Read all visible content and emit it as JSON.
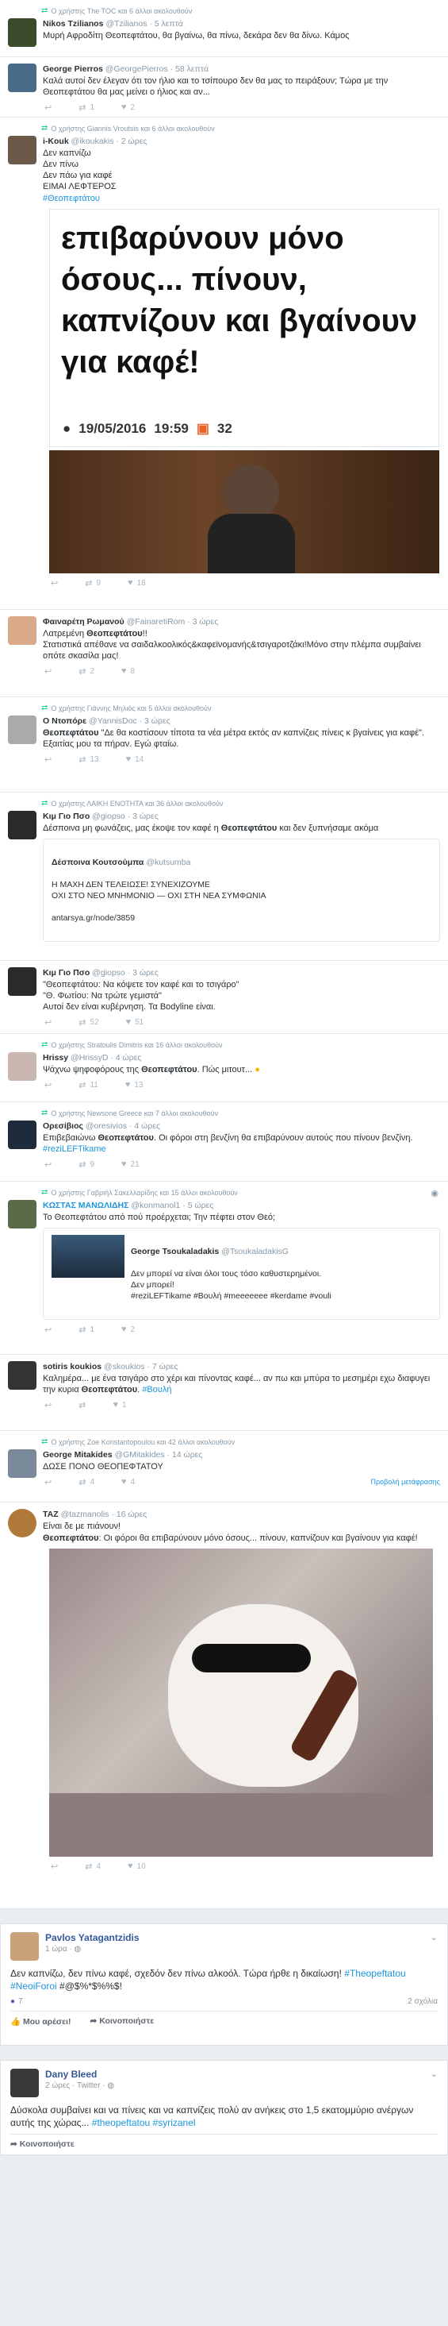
{
  "tweets": {
    "t1": {
      "rt": "Ο χρήστης The TOC και 6 άλλοι ακολουθούν",
      "name": "Nikos Tzilianos",
      "handle": "@Tzilianos · 5 λεπτά",
      "text": "Μυρή Αφροδίτη Θεοπεφτάτου, θα βγαίνω, θα πίνω, δεκάρα δεν θα δίνω. Κάμος"
    },
    "t2": {
      "name": "George Pierros",
      "handle": "@GeorgePierros · 58 λεπτά",
      "text": "Καλά αυτοί δεν έλεγαν ότι τον ήλιο και το τσίπουρο δεν θα μας το πειράξουν; Τώρα με την Θεοπεφτάτου θα μας μείνει ο ήλιος και αν...",
      "replies": "",
      "retweets": "1",
      "likes": "2"
    },
    "t3": {
      "rt": "Ο χρήστης Giannis Vroutsis και 6 άλλοι ακολουθούν",
      "name": "i-Kouk",
      "handle": "@ikoukakis · 2 ώρες",
      "text": "Δεν καπνίζω\nΔεν πίνω\nΔεν πάω για καφέ\nΕΙΜΑΙ ΛΕΦΤΕΡΟΣ",
      "hashtag": "#Θεοπεφτάτου",
      "card_text": "επιβαρύνουν μόνο όσους... πίνουν, καπνίζουν και βγαίνουν για καφέ!",
      "card_date": "19/05/2016",
      "card_time": "19:59",
      "card_comments": "32",
      "retweets": "9",
      "likes": "18"
    },
    "t4": {
      "name": "Φαιναρέτη Ρωμανού",
      "handle": "@FainaretiRom · 3 ώρες",
      "text_a": "Λατρεμένη ",
      "bold": "Θεοπεφτάτου",
      "text_b": "!!\nΣτατιστικά απέθανε να σαιδαλκοολικός&καφεϊνομανής&τσιγαροτζάκι!Μόνο στην πλέμπα συμβαίνει οπότε σκασίλα μας!",
      "retweets": "2",
      "likes": "8"
    },
    "t5": {
      "rt": "Ο χρήστης Γιάννης Μηλιός και 5 άλλοι ακολουθούν",
      "name": "Ο Ντοπόρε",
      "handle": "@YannisDoc · 3 ώρες",
      "bold": "Θεοπεφτάτου",
      "text_b": " \"Δε θα κοστίσουν τίποτα τα νέα μέτρα εκτός αν καπνίζεις πίνεις κ βγαίνεις για καφέ\".\nΕξαιτίας μου τα πήραν. Εγώ φταίω.",
      "retweets": "13",
      "likes": "14"
    },
    "t6": {
      "rt": "Ο χρήστης ΛΑΙΚΗ ΕΝΟΤΗΤΑ και 36 άλλοι ακολουθούν",
      "name": "Κιμ Γιο Πσο",
      "handle": "@giopso · 3 ώρες",
      "text_a": "Δέσποινα μη φωνάζεις, μας έκοψε τον καφέ η ",
      "bold": "Θεοπεφτάτου",
      "text_b": " και δεν ξυπνήσαμε ακόμα",
      "quote_name": "Δέσποινα Κουτσούμπα",
      "quote_handle": "@kutsumba",
      "quote_text": "Η ΜΑΧΗ ΔΕΝ ΤΕΛΕΙΩΣΕ! ΣΥΝΕΧΙΖΟΥΜΕ\nΟΧΙ ΣΤΟ ΝΕΟ ΜΝΗΜΟΝΙΟ — ΟΧΙ ΣΤΗ ΝΕΑ ΣΥΜΦΩΝΙΑ\n\nantarsya.gr/node/3859"
    },
    "t7": {
      "name": "Κιμ Γιο Πσο",
      "handle": "@giopso · 3 ώρες",
      "text": "\"Θεοπεφτάτου: Να κόψετε τον καφέ και το τσιγάρο\"\n\"Θ. Φωτίου: Να τρώτε γεμιστά\"\nΑυτοί δεν είναι κυβέρνηση. Τα Bodyline είναι.",
      "retweets": "52",
      "likes": "51"
    },
    "t8": {
      "rt": "Ο χρήστης Stratoulis Dimitris και 16 άλλοι ακολουθούν",
      "name": "Hrissy",
      "handle": "@HrissyD · 4 ώρες",
      "text_a": "Ψάχνω ψηφοφόρους της ",
      "bold": "Θεοπεφτάτου",
      "text_b": ". Πώς μιτουτ... ",
      "retweets": "11",
      "likes": "13"
    },
    "t9": {
      "rt": "Ο χρήστης Newsone Greece και 7 άλλοι ακολουθούν",
      "name": "Ορεσίβιος",
      "handle": "@oresivios · 4 ώρες",
      "text_a": "Επιβεβαιώνω ",
      "bold": "Θεοπεφτάτου",
      "text_b": ". Οι φόροι στη βενζίνη θα επιβαρύνουν αυτούς που πίνουν βενζίνη. ",
      "hashtag": "#reziLEFTikame",
      "retweets": "9",
      "likes": "21"
    },
    "t10": {
      "rt": "Ο χρήστης Γαβριήλ Σακελλαρίδης και 15 άλλοι ακολουθούν",
      "name": "ΚΩΣΤΑΣ ΜΑΝΩΛΙΔΗΣ",
      "handle": "@konmanol1 · 5 ώρες",
      "text": "Το Θεοπεφτάτου από πού προέρχεται; Την πέφτει στον Θεό;",
      "quote_name": "George Tsoukaladakis",
      "quote_handle": "@TsoukaladakisG",
      "quote_text": "Δεν μπορεί να είναι όλοι τους τόσο καθυστερημένοι.\nΔεν μπορεί!\n#reziLEFTikame #Βουλή #meeeeeee #kerdame #vouli",
      "retweets": "1",
      "likes": "2"
    },
    "t11": {
      "name": "sotiris koukios",
      "handle": "@skoukios · 7 ώρες",
      "text_a": "Καλημέρα... με ένα τσιγάρο στο χέρι και πίνοντας καφέ... αν πω και μπύρα το μεσημέρι εχω διαφυγει την κυρια ",
      "bold": "Θεοπεφτάτου",
      "text_b": ". ",
      "hashtag": "#Βουλή",
      "retweets": "",
      "likes": "1"
    },
    "t12": {
      "rt": "Ο χρήστης Zoe Konstantopoulou και 42 άλλοι ακολουθούν",
      "name": "George Mitakides",
      "handle": "@GMitakides · 14 ώρες",
      "text": "ΔΩΣΕ ΠΟΝΟ ΘΕΟΠΕΦΤΑΤΟΥ",
      "translate": "Προβολή μετάφρασης",
      "retweets": "4",
      "likes": "4"
    },
    "t13": {
      "name": "TAZ",
      "handle": "@tazmanolis · 16 ώρες",
      "text_pre": "Είναι δε με πιάνουν!",
      "bold": "Θεοπεφτάτου",
      "text_b": ": Οι φόροι θα επιβαρύνουν μόνο όσους... πίνουν, καπνίζουν και βγαίνουν για καφέ!",
      "retweets": "4",
      "likes": "10"
    }
  },
  "fb1": {
    "name": "Pavlos Yatagantzidis",
    "time": "1 ώρα · ",
    "text": "Δεν καπνίζω, δεν πίνω καφέ, σχεδόν δεν πίνω αλκοόλ. Τώρα ήρθε η δικαίωση! ",
    "hashtags": "#Theopeftatou #NeoiForoi",
    "tail": " #@$%*$%%$!",
    "reactions": "7",
    "comments": "2 σχόλια",
    "like_label": "Μου αρέσει!",
    "share_label": "Κοινοποιήστε"
  },
  "fb2": {
    "name": "Dany Bleed",
    "time": "2 ώρες · Twitter · ",
    "text": "Δύσκολα συμβαίνει και να πίνεις και να καπνίζεις πολύ αν ανήκεις στο 1,5 εκατομμύριο ανέργων αυτής της χώρας... ",
    "hashtags": "#theopeftatou #syrizanel",
    "share_label": "Κοινοποιήστε"
  },
  "icons": {
    "reply": "↩",
    "retweet": "⇄",
    "like": "♥",
    "comment": "▣"
  }
}
